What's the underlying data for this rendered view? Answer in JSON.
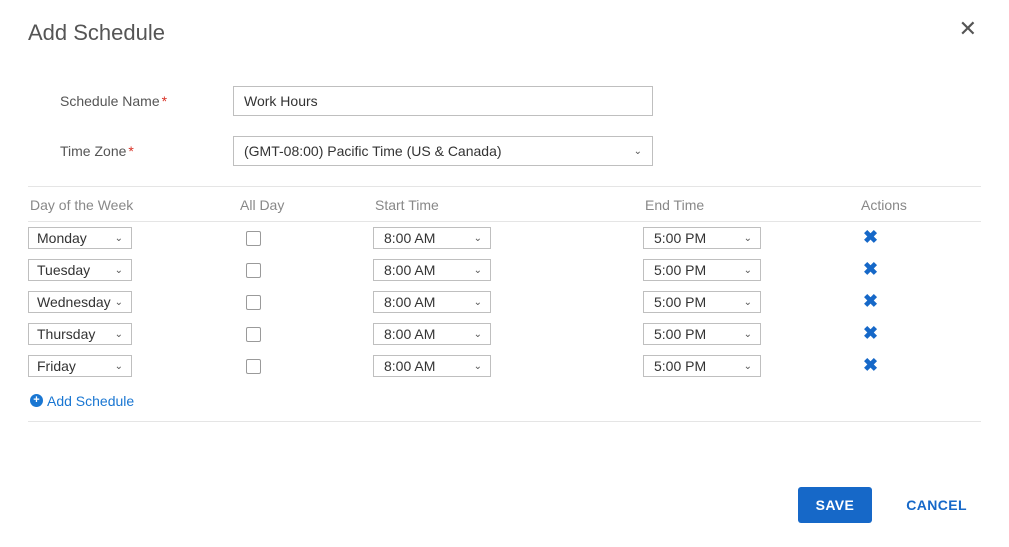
{
  "dialog": {
    "title": "Add Schedule"
  },
  "labels": {
    "schedule_name": "Schedule Name",
    "time_zone": "Time Zone"
  },
  "form": {
    "schedule_name_value": "Work Hours",
    "time_zone_value": "(GMT-08:00) Pacific Time (US & Canada)"
  },
  "grid": {
    "headers": {
      "day": "Day of the Week",
      "all_day": "All Day",
      "start": "Start Time",
      "end": "End Time",
      "actions": "Actions"
    },
    "rows": [
      {
        "day": "Monday",
        "all_day": false,
        "start": "8:00 AM",
        "end": "5:00 PM"
      },
      {
        "day": "Tuesday",
        "all_day": false,
        "start": "8:00 AM",
        "end": "5:00 PM"
      },
      {
        "day": "Wednesday",
        "all_day": false,
        "start": "8:00 AM",
        "end": "5:00 PM"
      },
      {
        "day": "Thursday",
        "all_day": false,
        "start": "8:00 AM",
        "end": "5:00 PM"
      },
      {
        "day": "Friday",
        "all_day": false,
        "start": "8:00 AM",
        "end": "5:00 PM"
      }
    ],
    "add_link": "Add Schedule"
  },
  "buttons": {
    "save": "SAVE",
    "cancel": "CANCEL"
  },
  "glyphs": {
    "required": "*",
    "remove": "✖",
    "plus": "+",
    "close": "✕"
  }
}
